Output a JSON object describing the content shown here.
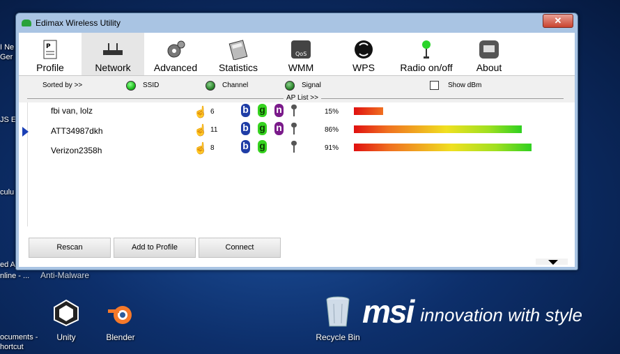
{
  "window": {
    "title": "Edimax Wireless Utility",
    "close": "✕"
  },
  "toolbar": [
    {
      "label": "Profile"
    },
    {
      "label": "Network"
    },
    {
      "label": "Advanced"
    },
    {
      "label": "Statistics"
    },
    {
      "label": "WMM"
    },
    {
      "label": "WPS"
    },
    {
      "label": "Radio on/off"
    },
    {
      "label": "About"
    }
  ],
  "sort": {
    "label": "Sorted by >>",
    "ssid": "SSID",
    "channel": "Channel",
    "signal": "Signal",
    "show_dbm": "Show dBm"
  },
  "aplist": {
    "title": "AP List >>",
    "rows": [
      {
        "ssid": "fbi van, lolz",
        "channel": "6",
        "modes": [
          "b",
          "g",
          "n"
        ],
        "percent": "15%",
        "signal": 15
      },
      {
        "ssid": "ATT34987dkh",
        "channel": "11",
        "modes": [
          "b",
          "g",
          "n"
        ],
        "percent": "86%",
        "signal": 86
      },
      {
        "ssid": "Verizon2358h",
        "channel": "8",
        "modes": [
          "b",
          "g"
        ],
        "percent": "91%",
        "signal": 91
      }
    ]
  },
  "buttons": {
    "rescan": "Rescan",
    "add_profile": "Add to Profile",
    "connect": "Connect"
  },
  "desktop": {
    "unity": "Unity",
    "blender": "Blender",
    "recycle": "Recycle Bin",
    "anti_malware": "Anti-Malware",
    "documents": "ocuments -",
    "shortcut": "hortcut",
    "online": "nline - ...",
    "left1": "I Ne",
    "left2": "Ger",
    "left3": "JS E",
    "left4": "culu",
    "left5": "ed A"
  },
  "brand": {
    "logo": "msi",
    "tagline": "innovation with style"
  },
  "colors": {
    "selection": "#1a3fb5",
    "window_frame": "#a9c4e3"
  }
}
